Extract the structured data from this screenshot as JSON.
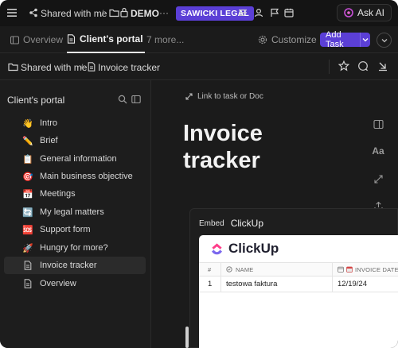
{
  "topbar": {
    "breadcrumb_space": "Shared with me",
    "breadcrumb_sep": "/",
    "folder_name": "DEMO",
    "more_label": "···",
    "badge": "SAWICKI LEGAL",
    "ask_ai": "Ask AI"
  },
  "tabs": {
    "overview": "Overview",
    "clients_portal": "Client's portal",
    "more": "7 more...",
    "customize": "Customize",
    "add_task": "Add Task"
  },
  "breadcrumb": {
    "shared": "Shared with me",
    "sep": "/",
    "doc": "Invoice tracker"
  },
  "sidebar": {
    "title": "Client's portal",
    "items": [
      {
        "emoji": "👋",
        "label": "Intro"
      },
      {
        "emoji": "✏️",
        "label": "Brief"
      },
      {
        "emoji": "📋",
        "label": "General information"
      },
      {
        "emoji": "🎯",
        "label": "Main business objective"
      },
      {
        "emoji": "📅",
        "label": "Meetings"
      },
      {
        "emoji": "🔄",
        "label": "My legal matters"
      },
      {
        "emoji": "🆘",
        "label": "Support form"
      },
      {
        "emoji": "🚀",
        "label": "Hungry for more?"
      },
      {
        "emoji": "doc",
        "label": "Invoice tracker"
      },
      {
        "emoji": "doc",
        "label": "Overview"
      }
    ]
  },
  "main": {
    "link_task": "Link to task or Doc",
    "title": "Invoice tracker",
    "embed": {
      "label": "Embed",
      "name": "ClickUp",
      "logo_text": "ClickUp",
      "columns": [
        "#",
        "NAME",
        "INVOICE DATE"
      ],
      "rows": [
        {
          "num": "1",
          "name": "testowa faktura",
          "date": "12/19/24"
        }
      ]
    },
    "tools": {
      "font_label": "Aa"
    }
  },
  "colors": {
    "accent": "#5b3fd6",
    "background": "#1b1b1b"
  }
}
